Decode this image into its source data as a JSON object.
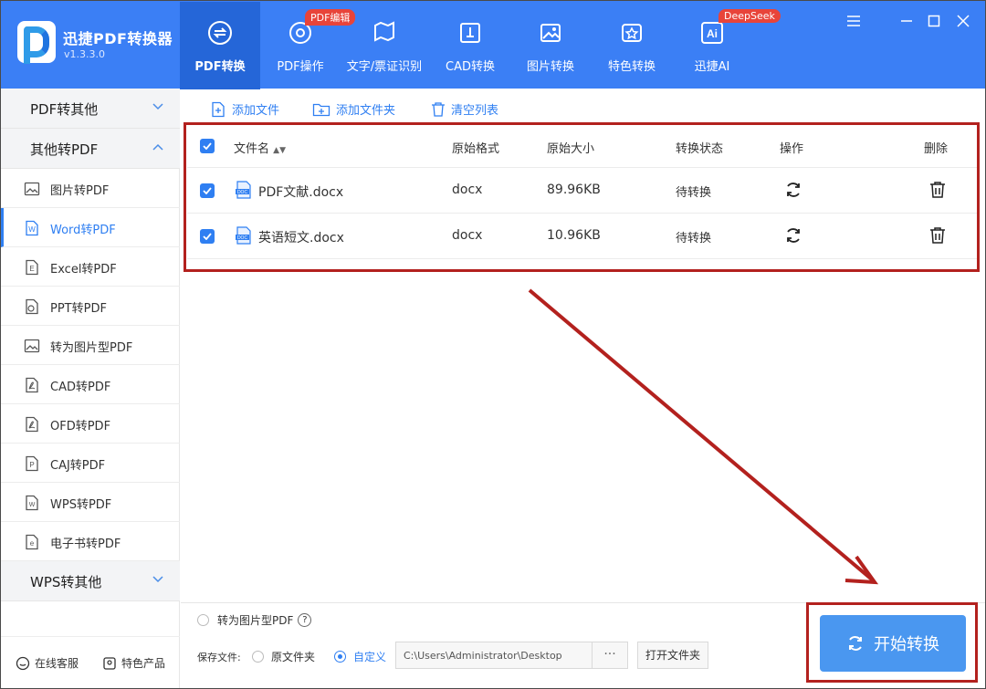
{
  "app": {
    "name": "迅捷PDF转换器",
    "version": "v1.3.3.0"
  },
  "tabs": [
    {
      "label": "PDF转换",
      "icon": "convert-icon",
      "active": true
    },
    {
      "label": "PDF操作",
      "icon": "pdf-ops-icon",
      "badge": "PDF编辑"
    },
    {
      "label": "文字/票证识别",
      "icon": "ocr-icon"
    },
    {
      "label": "CAD转换",
      "icon": "cad-icon"
    },
    {
      "label": "图片转换",
      "icon": "image-icon"
    },
    {
      "label": "特色转换",
      "icon": "star-icon"
    },
    {
      "label": "迅捷AI",
      "icon": "ai-icon",
      "badge": "DeepSeek",
      "icon_text": "Ai"
    }
  ],
  "sidebar": {
    "categories": [
      {
        "label": "PDF转其他",
        "expanded": false
      },
      {
        "label": "其他转PDF",
        "expanded": true
      },
      {
        "label": "WPS转其他",
        "expanded": false
      }
    ],
    "items": [
      {
        "label": "图片转PDF",
        "icon": "image-file-icon"
      },
      {
        "label": "Word转PDF",
        "icon": "word-file-icon",
        "icon_text": "W",
        "active": true
      },
      {
        "label": "Excel转PDF",
        "icon": "excel-file-icon",
        "icon_text": "E"
      },
      {
        "label": "PPT转PDF",
        "icon": "ppt-file-icon"
      },
      {
        "label": "转为图片型PDF",
        "icon": "image-file-icon"
      },
      {
        "label": "CAD转PDF",
        "icon": "pdf-file-icon"
      },
      {
        "label": "OFD转PDF",
        "icon": "pdf-file-icon"
      },
      {
        "label": "CAJ转PDF",
        "icon": "caj-file-icon",
        "icon_text": "P"
      },
      {
        "label": "WPS转PDF",
        "icon": "wps-file-icon",
        "icon_text": "W"
      },
      {
        "label": "电子书转PDF",
        "icon": "ebook-file-icon",
        "icon_text": "e"
      }
    ],
    "bottom": [
      {
        "label": "在线客服",
        "icon": "chat-icon"
      },
      {
        "label": "特色产品",
        "icon": "product-icon"
      }
    ]
  },
  "toolbar": {
    "add_file": "添加文件",
    "add_folder": "添加文件夹",
    "clear_list": "清空列表"
  },
  "table": {
    "headers": {
      "name": "文件名",
      "format": "原始格式",
      "size": "原始大小",
      "status": "转换状态",
      "action": "操作",
      "delete": "删除"
    },
    "rows": [
      {
        "name": "PDF文献.docx",
        "format": "docx",
        "size": "89.96KB",
        "status": "待转换",
        "icon_text": "DOC"
      },
      {
        "name": "英语短文.docx",
        "format": "docx",
        "size": "10.96KB",
        "status": "待转换",
        "icon_text": "DOC"
      }
    ]
  },
  "options": {
    "to_image_pdf": "转为图片型PDF",
    "help_mark": "?",
    "save_label": "保存文件:",
    "save_original": "原文件夹",
    "save_custom": "自定义",
    "path": "C:\\Users\\Administrator\\Desktop",
    "browse": "···",
    "open_folder": "打开文件夹",
    "start": "开始转换"
  },
  "colors": {
    "header": "#3b7ff5",
    "accent": "#2f7ff2",
    "start": "#4a97f0",
    "highlight_box": "#b3211e"
  }
}
